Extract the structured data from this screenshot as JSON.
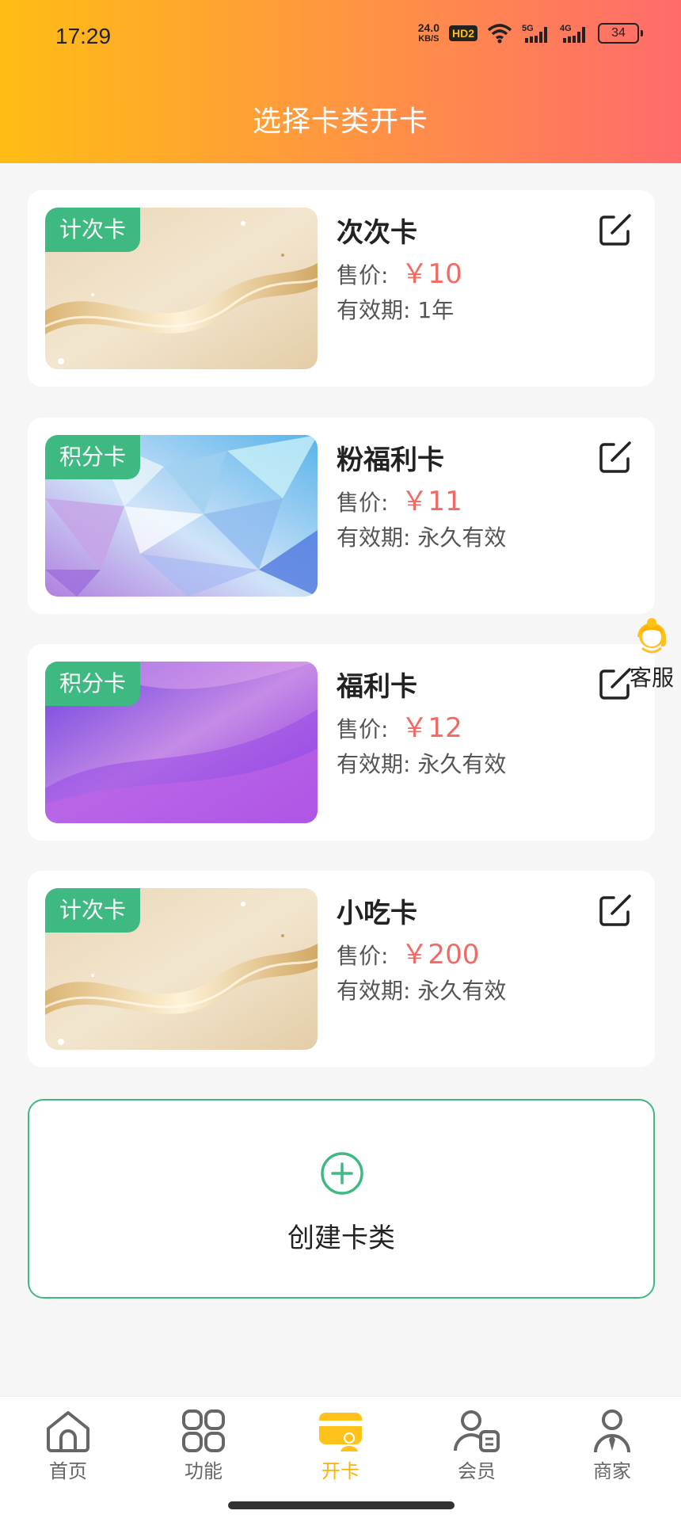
{
  "status_bar": {
    "time": "17:29",
    "speed_value": "24.0",
    "speed_unit": "KB/S",
    "hd": "HD2",
    "net1": "5G",
    "net2": "4G",
    "battery": "34"
  },
  "header": {
    "title": "选择卡类开卡"
  },
  "colors": {
    "accent_green": "#3fb982",
    "price_red": "#f26a63",
    "tab_active": "#ffb300"
  },
  "price_label": "售价:",
  "valid_label": "有效期:",
  "cards": [
    {
      "badge": "计次卡",
      "name": "次次卡",
      "price": "￥10",
      "validity": "1年",
      "image": "gold-wave"
    },
    {
      "badge": "积分卡",
      "name": "粉福利卡",
      "price": "￥11",
      "validity": "永久有效",
      "image": "blue-crystal"
    },
    {
      "badge": "积分卡",
      "name": "福利卡",
      "price": "￥12",
      "validity": "永久有效",
      "image": "purple-gradient"
    },
    {
      "badge": "计次卡",
      "name": "小吃卡",
      "price": "￥200",
      "validity": "永久有效",
      "image": "gold-wave"
    }
  ],
  "customer_service": {
    "label": "客服",
    "icon": "headset-avatar-icon"
  },
  "create": {
    "label": "创建卡类",
    "icon": "plus-circle-icon"
  },
  "tabs": [
    {
      "label": "首页",
      "icon": "home-icon",
      "active": false
    },
    {
      "label": "功能",
      "icon": "grid-icon",
      "active": false
    },
    {
      "label": "开卡",
      "icon": "card-icon",
      "active": true
    },
    {
      "label": "会员",
      "icon": "member-icon",
      "active": false
    },
    {
      "label": "商家",
      "icon": "merchant-icon",
      "active": false
    }
  ]
}
